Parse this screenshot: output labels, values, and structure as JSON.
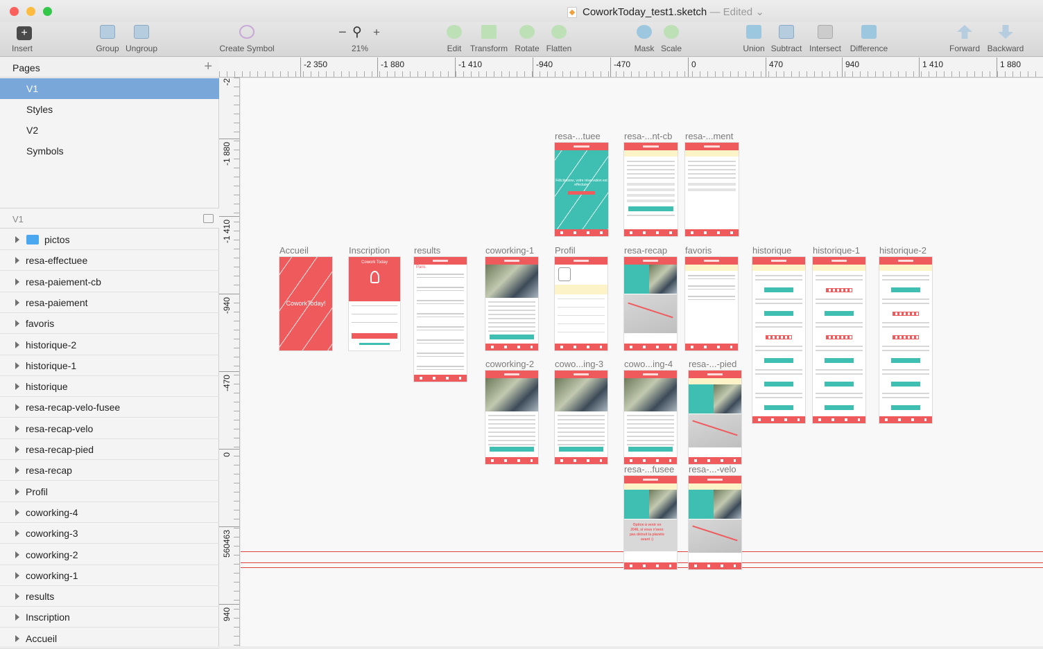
{
  "window": {
    "filename": "CoworkToday_test1.sketch",
    "status": "— Edited",
    "chevron": "⌄"
  },
  "toolbar": {
    "insert": "Insert",
    "group": "Group",
    "ungroup": "Ungroup",
    "create_symbol": "Create Symbol",
    "zoom": "21%",
    "zoom_minus": "−",
    "zoom_plus": "+",
    "edit": "Edit",
    "transform": "Transform",
    "rotate": "Rotate",
    "flatten": "Flatten",
    "mask": "Mask",
    "scale": "Scale",
    "union": "Union",
    "subtract": "Subtract",
    "intersect": "Intersect",
    "difference": "Difference",
    "forward": "Forward",
    "backward": "Backward",
    "colors": {
      "accent": "#ef5a5c",
      "teal": "#3fbfb2",
      "selection": "#7aa7d9"
    }
  },
  "pages": {
    "title": "Pages",
    "add": "+",
    "items": [
      "V1",
      "Styles",
      "V2",
      "Symbols"
    ],
    "selected": "V1"
  },
  "layers": {
    "title": "V1",
    "items": [
      "pictos",
      "resa-effectuee",
      "resa-paiement-cb",
      "resa-paiement",
      "favoris",
      "historique-2",
      "historique-1",
      "historique",
      "resa-recap-velo-fusee",
      "resa-recap-velo",
      "resa-recap-pied",
      "resa-recap",
      "Profil",
      "coworking-4",
      "coworking-3",
      "coworking-2",
      "coworking-1",
      "results",
      "Inscription",
      "Accueil"
    ]
  },
  "rulers": {
    "top": [
      "-2 350",
      "-1 880",
      "-1 410",
      "-940",
      "-470",
      "0",
      "470",
      "940",
      "1 410",
      "1 880"
    ],
    "left": [
      "-2",
      "-1 880",
      "-1 410",
      "-940",
      "-470",
      "0",
      "560463",
      "940"
    ]
  },
  "artboards": {
    "accueil": {
      "label": "Accueil",
      "brand": "CoworkToday!"
    },
    "inscription": {
      "label": "Inscription",
      "app": "Cowork Today"
    },
    "results": {
      "label": "results",
      "app": "Cowork Today",
      "city": "Paris"
    },
    "coworking1": {
      "label": "coworking-1",
      "app": "Cowork Today"
    },
    "profil": {
      "label": "Profil",
      "app": "Cowork Today"
    },
    "resa_recap": {
      "label": "resa-recap",
      "app": "Cowork Today"
    },
    "favoris": {
      "label": "favoris",
      "app": "Cowork Today"
    },
    "historique": {
      "label": "historique",
      "app": "Cowork Today",
      "sub": "Historique"
    },
    "historique1": {
      "label": "historique-1",
      "app": "Cowork Today",
      "sub": "Historique"
    },
    "historique2": {
      "label": "historique-2",
      "app": "Cowork Today",
      "sub": "Historique"
    },
    "resa_effectuee": {
      "label": "resa-...tuee",
      "app": "Cowork Today",
      "msg": "Félicitations, votre réservation est effectuée"
    },
    "resa_paiement_cb": {
      "label": "resa-...nt-cb",
      "app": "Cowork Today",
      "sub": "Réservez votre place"
    },
    "resa_paiement": {
      "label": "resa-...ment",
      "app": "Cowork Today",
      "sub": "Réservez votre place"
    },
    "coworking2": {
      "label": "coworking-2",
      "app": "Cowork Today"
    },
    "coworking3": {
      "label": "cowo...ing-3",
      "app": "Cowork Today"
    },
    "coworking4": {
      "label": "cowo...ing-4",
      "app": "Cowork Today"
    },
    "resa_recap_pied": {
      "label": "resa-...-pied",
      "app": "Cowork Today",
      "sub": "Mes réservations"
    },
    "resa_recap_fusee": {
      "label": "resa-...fusee",
      "app": "Cowork Today",
      "sub": "Mes réservations",
      "msg": "Option à venir en 2046, si vous n'avez pas détruit la planète avant :)"
    },
    "resa_recap_velo": {
      "label": "resa-...-velo",
      "app": "Cowork Today",
      "sub": "Mes réservations"
    }
  }
}
